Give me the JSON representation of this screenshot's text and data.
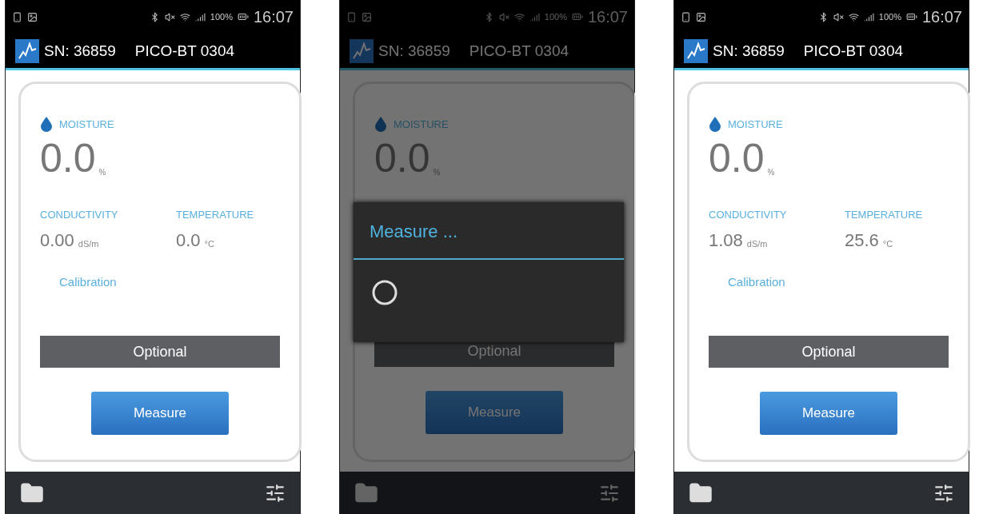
{
  "screens": [
    {
      "status": {
        "battery": "100%",
        "time": "16:07"
      },
      "app_bar": {
        "serial": "SN: 36859",
        "device": "PICO-BT 0304"
      },
      "moisture": {
        "label": "MOISTURE",
        "value": "0.0",
        "unit": "%"
      },
      "conductivity": {
        "label": "CONDUCTIVITY",
        "value": "0.00",
        "unit": "dS/m"
      },
      "temperature": {
        "label": "TEMPERATURE",
        "value": "0.0",
        "unit": "°C"
      },
      "calibration": "Calibration",
      "optional_button": "Optional",
      "measure_button": "Measure",
      "dimmed": false
    },
    {
      "status": {
        "battery": "100%",
        "time": "16:07"
      },
      "app_bar": {
        "serial": "SN: 36859",
        "device": "PICO-BT 0304"
      },
      "moisture": {
        "label": "MOISTURE",
        "value": "0.0",
        "unit": "%"
      },
      "optional_button": "Optional",
      "measure_button": "Measure",
      "dimmed": true,
      "dialog": {
        "title": "Measure ..."
      }
    },
    {
      "status": {
        "battery": "100%",
        "time": "16:07"
      },
      "app_bar": {
        "serial": "SN: 36859",
        "device": "PICO-BT 0304"
      },
      "moisture": {
        "label": "MOISTURE",
        "value": "0.0",
        "unit": "%"
      },
      "conductivity": {
        "label": "CONDUCTIVITY",
        "value": "1.08",
        "unit": "dS/m"
      },
      "temperature": {
        "label": "TEMPERATURE",
        "value": "25.6",
        "unit": "°C"
      },
      "calibration": "Calibration",
      "optional_button": "Optional",
      "measure_button": "Measure",
      "dimmed": false
    }
  ]
}
